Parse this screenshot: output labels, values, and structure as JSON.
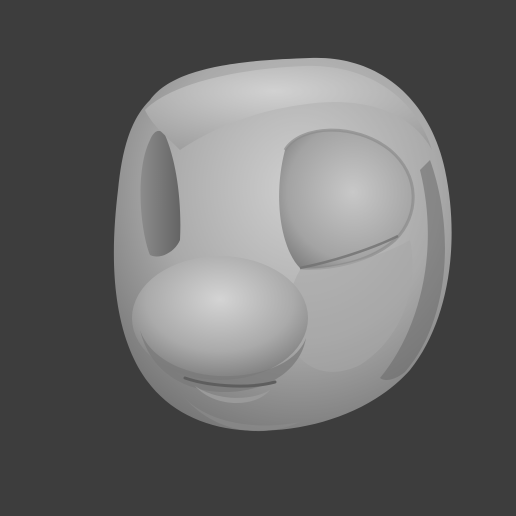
{
  "viewport": {
    "background_color": "#3d3d3d",
    "subject": "sculpted-head-model",
    "material_colors": {
      "highlight": "#d2d2d2",
      "base": "#a6a6a6",
      "shadow": "#6f6f6f",
      "deep_shadow": "#5a5a5a"
    }
  }
}
